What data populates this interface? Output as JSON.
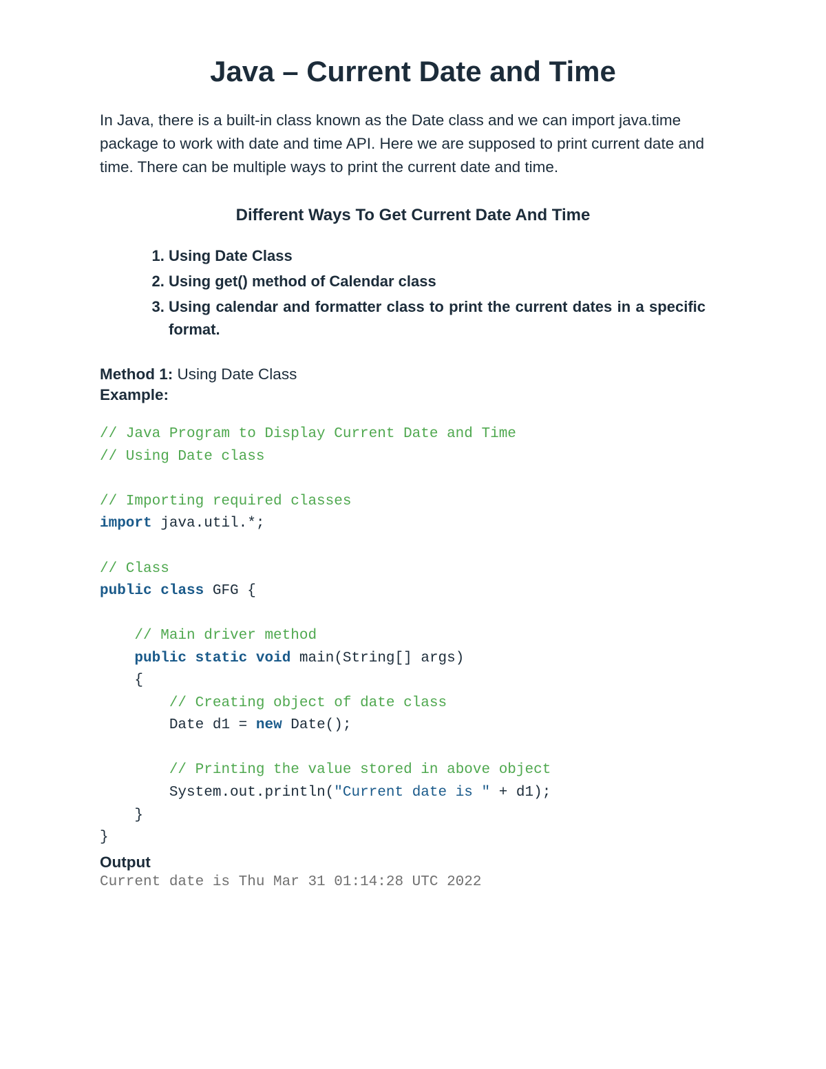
{
  "title": "Java – Current Date and Time",
  "intro": "In Java, there is a built-in class known as the Date class and we can import java.time package to work with date and time API. Here we are supposed to print current date and time. There can be multiple ways to print the current date and time.",
  "subheading": "Different Ways To Get Current Date And Time",
  "ways": [
    "Using Date Class",
    "Using get() method of Calendar class",
    "Using calendar and formatter class to print the current dates in a specific format."
  ],
  "method1": {
    "label_prefix": "Method 1:",
    "label_text": " Using Date Class",
    "example_label": "Example:"
  },
  "code": {
    "c1": "// Java Program to Display Current Date and Time",
    "c2": "// Using Date class",
    "c3": "// Importing required classes",
    "kw_import": "import",
    "import_rest": " java.util.*;",
    "c4": "// Class",
    "kw_public": "public",
    "kw_class": "class",
    "class_rest": " GFG {",
    "c5": "// Main driver method",
    "kw_public2": "public",
    "kw_static": "static",
    "kw_void": "void",
    "main_sig": " main(String[] args)",
    "brace_open": "{",
    "c6": "// Creating object of date class",
    "date_decl_pre": "Date d1 = ",
    "kw_new": "new",
    "date_decl_post": " Date();",
    "c7": "// Printing the value stored in above object",
    "println_pre": "System.out.println(",
    "str_literal": "\"Current date is \"",
    "println_post": " + d1);",
    "brace_close_inner": "}",
    "brace_close_outer": "}"
  },
  "output": {
    "label": "Output",
    "text": "Current date is Thu Mar 31 01:14:28 UTC 2022"
  }
}
